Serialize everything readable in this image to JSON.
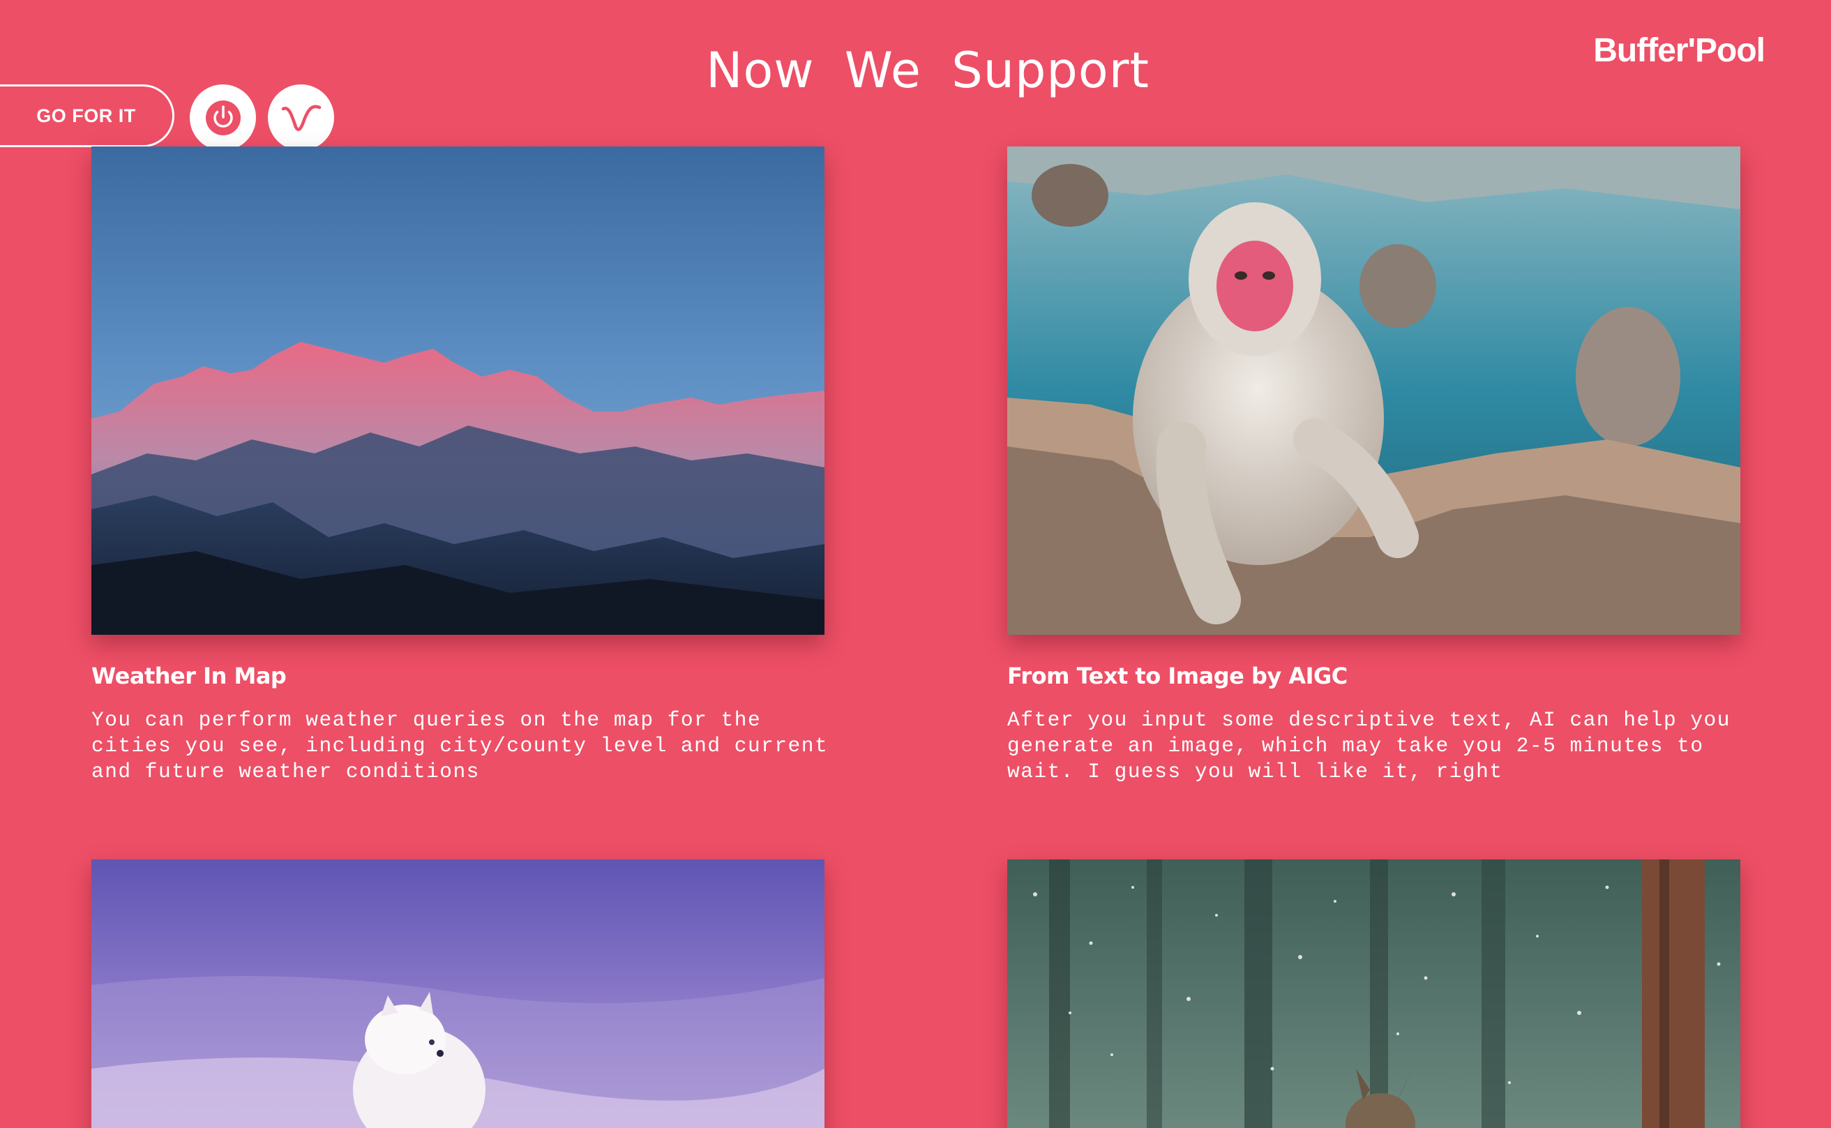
{
  "header": {
    "title": "Now We Support",
    "brand": "Buffer'Pool"
  },
  "toolbar": {
    "go_label": "GO FOR IT",
    "power_icon": "power-icon",
    "wave_icon": "wave-icon"
  },
  "colors": {
    "background": "#ed4f66",
    "text": "#ffffff",
    "button_icon": "#ed4f66"
  },
  "cards": [
    {
      "title": "Weather In Map",
      "description": "You can perform weather queries on the map for the cities you see, including city/county level and current and future weather conditions",
      "image": "mountain-range-photo"
    },
    {
      "title": "From Text to Image by AIGC",
      "description": "After you input some descriptive text, AI can help you generate an image, which may take you 2-5 minutes to wait. I guess you will like it, right",
      "image": "snow-monkey-photo"
    },
    {
      "image": "arctic-fox-photo"
    },
    {
      "image": "snowy-forest-deer-photo"
    }
  ]
}
